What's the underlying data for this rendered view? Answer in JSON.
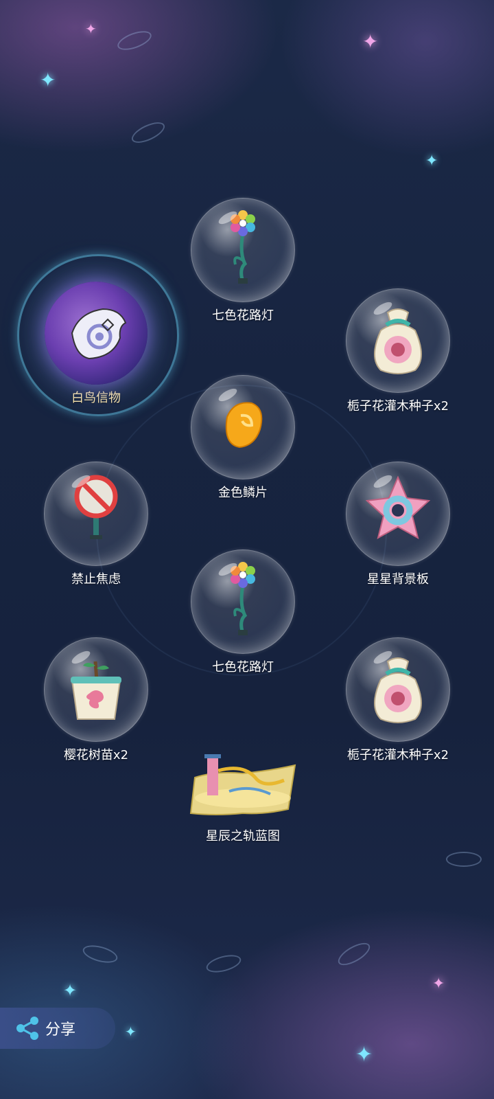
{
  "rewards": [
    {
      "id": "bird-token",
      "label": "白鸟信物",
      "icon": "white-bird-token-icon",
      "highlighted": true
    },
    {
      "id": "lamp-1",
      "label": "七色花路灯",
      "icon": "rainbow-flower-lamp-icon"
    },
    {
      "id": "seed-1",
      "label": "栀子花灌木种子x2",
      "icon": "seed-bag-icon"
    },
    {
      "id": "scale",
      "label": "金色鳞片",
      "icon": "golden-scale-icon"
    },
    {
      "id": "no-anxiety",
      "label": "禁止焦虑",
      "icon": "no-anxiety-sign-icon"
    },
    {
      "id": "star-board",
      "label": "星星背景板",
      "icon": "star-backdrop-icon"
    },
    {
      "id": "lamp-2",
      "label": "七色花路灯",
      "icon": "rainbow-flower-lamp-icon"
    },
    {
      "id": "sapling",
      "label": "樱花树苗x2",
      "icon": "potted-sapling-icon"
    },
    {
      "id": "seed-2",
      "label": "栀子花灌木种子x2",
      "icon": "seed-bag-icon"
    },
    {
      "id": "blueprint",
      "label": "星辰之轨蓝图",
      "icon": "blueprint-scroll-icon"
    }
  ],
  "share": {
    "label": "分享",
    "icon": "share-icon"
  },
  "colors": {
    "highlight_label": "#ffe7a8",
    "label": "#ffffff",
    "bg": "#172440"
  }
}
